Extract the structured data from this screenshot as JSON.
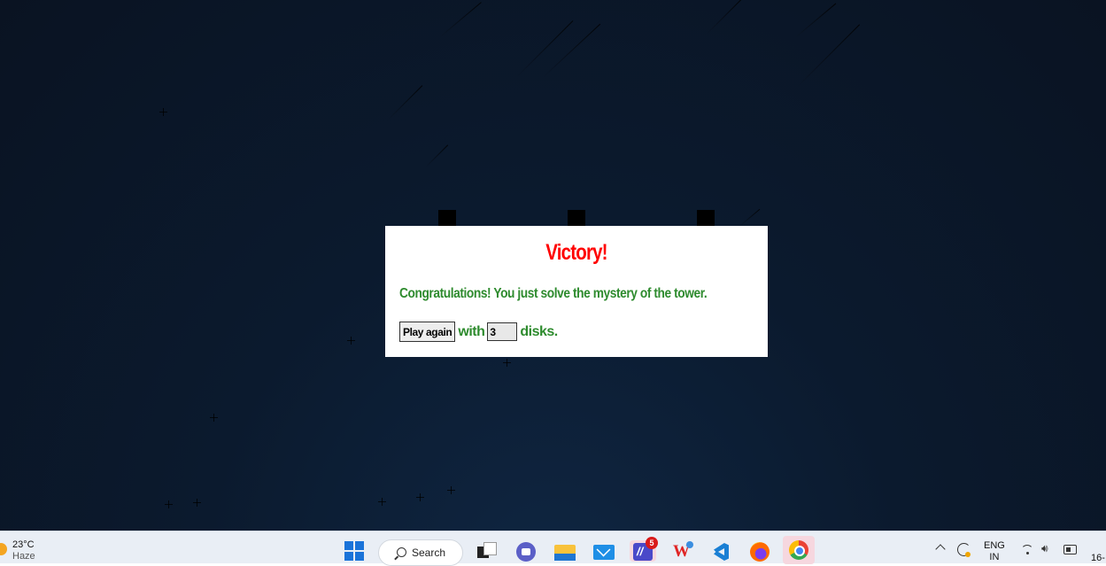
{
  "dialog": {
    "title": "Victory!",
    "message": "Congratulations! You just solve the mystery of the tower.",
    "play_again_label": "Play again",
    "with_label": "with",
    "disk_count": "3",
    "disks_label": "disks.",
    "title_color": "#ff0000",
    "text_color": "#2e8b2e"
  },
  "game": {
    "peg_count": 3
  },
  "taskbar": {
    "weather": {
      "temperature": "23°C",
      "condition": "Haze",
      "icon": "sun-haze-icon"
    },
    "search_label": "Search",
    "apps": [
      {
        "name": "task-view",
        "icon": "task-view-icon"
      },
      {
        "name": "meet",
        "icon": "video-chat-icon"
      },
      {
        "name": "file-explorer",
        "icon": "folder-icon"
      },
      {
        "name": "mail",
        "icon": "mail-icon"
      },
      {
        "name": "editor",
        "icon": "editor-icon",
        "badge": "5"
      },
      {
        "name": "wps-office",
        "icon": "wps-icon"
      },
      {
        "name": "vscode",
        "icon": "vscode-icon"
      },
      {
        "name": "firefox",
        "icon": "firefox-icon"
      },
      {
        "name": "chrome",
        "icon": "chrome-icon",
        "active": true
      }
    ],
    "tray": {
      "language_top": "ENG",
      "language_bottom": "IN",
      "clock_partial": "16-"
    }
  }
}
